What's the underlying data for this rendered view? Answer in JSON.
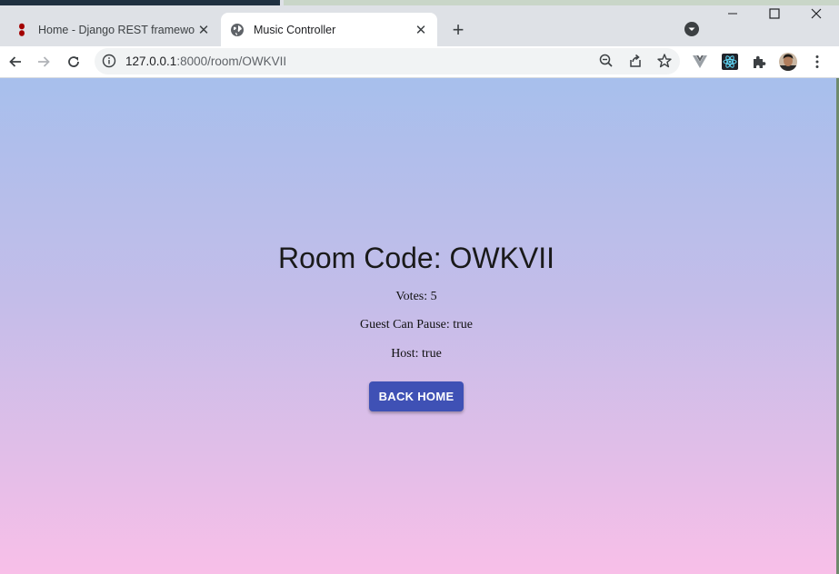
{
  "browser": {
    "tabs": [
      {
        "title": "Home - Django REST framework",
        "favicon": "django-rest-icon",
        "active": false
      },
      {
        "title": "Music Controller",
        "favicon": "globe-icon",
        "active": true
      }
    ],
    "new_tab_label": "+",
    "url_host": "127.0.0.1",
    "url_rest": ":8000/room/OWKVII"
  },
  "room": {
    "title": "Room Code: OWKVII",
    "votes": "Votes: 5",
    "guest_can_pause": "Guest Can Pause: true",
    "host": "Host: true",
    "back_button": "BACK HOME"
  },
  "colors": {
    "button": "#3f51b5",
    "gradient_top": "#a7bfec",
    "gradient_bottom": "#f8bfe8"
  }
}
